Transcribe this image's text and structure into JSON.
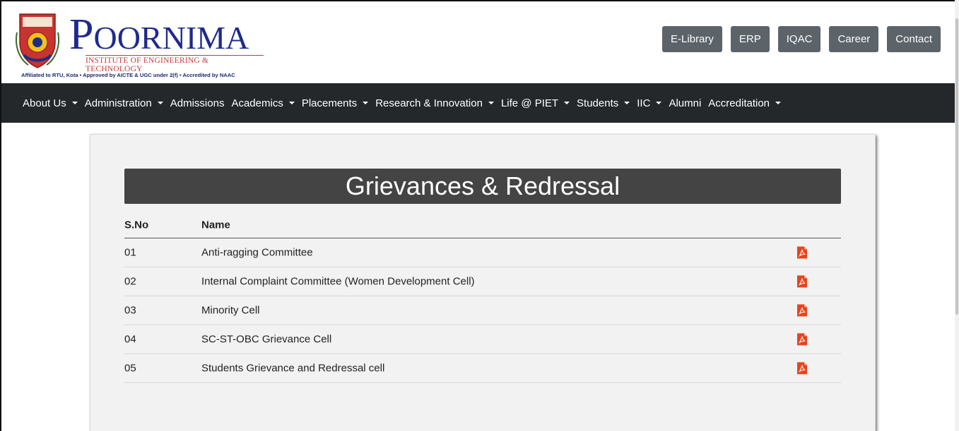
{
  "header": {
    "brand_first": "P",
    "brand_rest": "OORNIMA",
    "brand_sub": "INSTITUTE OF ENGINEERING & TECHNOLOGY",
    "affiliation": "Affiliated to RTU, Kota • Approved by AICTE & UGC under 2(f) • Accredited by NAAC",
    "crest_icon": "college-crest-icon",
    "top_links": [
      "E-Library",
      "ERP",
      "IQAC",
      "Career",
      "Contact"
    ]
  },
  "nav": {
    "items": [
      {
        "label": "About Us",
        "dropdown": true
      },
      {
        "label": "Administration",
        "dropdown": true
      },
      {
        "label": "Admissions",
        "dropdown": false
      },
      {
        "label": "Academics",
        "dropdown": true
      },
      {
        "label": "Placements",
        "dropdown": true
      },
      {
        "label": "Research & Innovation",
        "dropdown": true
      },
      {
        "label": "Life @ PIET",
        "dropdown": true
      },
      {
        "label": "Students",
        "dropdown": true
      },
      {
        "label": "IIC",
        "dropdown": true
      },
      {
        "label": "Alumni",
        "dropdown": false
      },
      {
        "label": "Accreditation",
        "dropdown": true
      }
    ]
  },
  "page": {
    "title": "Grievances & Redressal",
    "columns": {
      "sno": "S.No",
      "name": "Name"
    },
    "rows": [
      {
        "sno": "01",
        "name": "Anti-ragging Committee",
        "doc_icon": "pdf-icon"
      },
      {
        "sno": "02",
        "name": "Internal Complaint Committee (Women Development Cell)",
        "doc_icon": "pdf-icon"
      },
      {
        "sno": "03",
        "name": "Minority Cell",
        "doc_icon": "pdf-icon"
      },
      {
        "sno": "04",
        "name": "SC-ST-OBC Grievance Cell",
        "doc_icon": "pdf-icon"
      },
      {
        "sno": "05",
        "name": "Students Grievance and Redressal cell",
        "doc_icon": "pdf-icon"
      }
    ]
  },
  "colors": {
    "brand_blue": "#1f2a8c",
    "brand_red": "#c33d3d",
    "nav_bg": "#25282b",
    "top_btn_bg": "#5c6369",
    "title_bar_bg": "#444444",
    "pdf_red": "#e8431c"
  }
}
